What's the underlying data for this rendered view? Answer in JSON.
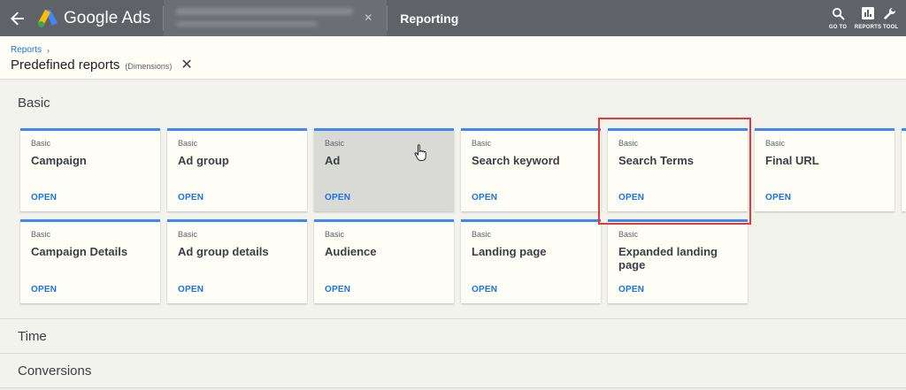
{
  "topbar": {
    "app_name": "Google Ads",
    "page_name": "Reporting",
    "back_icon": "back-arrow-icon",
    "actions": [
      {
        "label": "GO TO",
        "icon": "search-icon"
      },
      {
        "label": "REPORTS",
        "icon": "reports-icon"
      },
      {
        "label": "TOOL",
        "icon": "wrench-icon"
      }
    ]
  },
  "header": {
    "breadcrumb": "Reports",
    "title": "Predefined reports",
    "subtitle": "(Dimensions)"
  },
  "sections": {
    "basic": "Basic",
    "time": "Time",
    "conversions": "Conversions"
  },
  "cards": [
    {
      "category": "Basic",
      "title": "Campaign",
      "action": "OPEN"
    },
    {
      "category": "Basic",
      "title": "Ad group",
      "action": "OPEN"
    },
    {
      "category": "Basic",
      "title": "Ad",
      "action": "OPEN"
    },
    {
      "category": "Basic",
      "title": "Search keyword",
      "action": "OPEN"
    },
    {
      "category": "Basic",
      "title": "Search Terms",
      "action": "OPEN"
    },
    {
      "category": "Basic",
      "title": "Final URL",
      "action": "OPEN"
    },
    {
      "category": "Basic",
      "title": "Campaign Details",
      "action": "OPEN"
    },
    {
      "category": "Basic",
      "title": "Ad group details",
      "action": "OPEN"
    },
    {
      "category": "Basic",
      "title": "Audience",
      "action": "OPEN"
    },
    {
      "category": "Basic",
      "title": "Landing page",
      "action": "OPEN"
    },
    {
      "category": "Basic",
      "title": "Expanded landing page",
      "action": "OPEN"
    }
  ],
  "colors": {
    "topbar": "#5f6368",
    "accent_blue": "#4285f4",
    "link_blue": "#1a73e8",
    "highlight_red": "#e53935"
  }
}
